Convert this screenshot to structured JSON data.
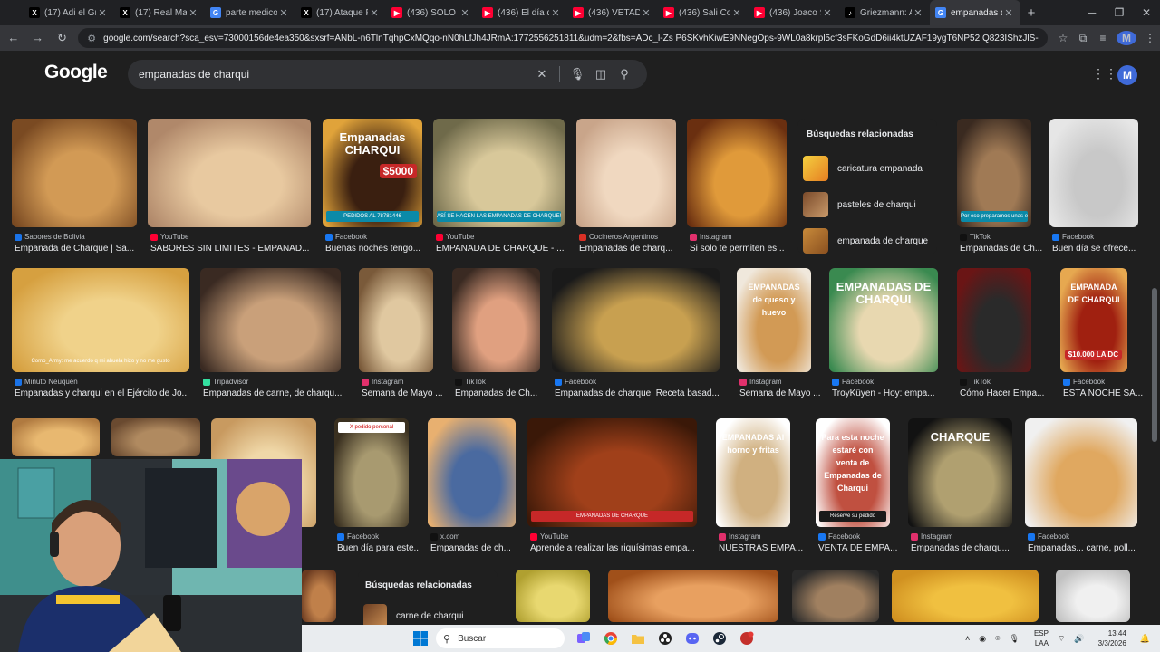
{
  "tabs": [
    {
      "title": "(17) Adi el Gra",
      "favicon": "x-icon",
      "color": "#000000",
      "active": false
    },
    {
      "title": "(17) Real Madr",
      "favicon": "x-icon",
      "color": "#000000",
      "active": false
    },
    {
      "title": "parte medico",
      "favicon": "google-icon",
      "color": "#4285f4",
      "active": false
    },
    {
      "title": "(17) Ataque Fu",
      "favicon": "x-icon",
      "color": "#000000",
      "active": false
    },
    {
      "title": "(436) SOLO en",
      "favicon": "youtube-icon",
      "color": "#ff0033",
      "active": false
    },
    {
      "title": "(436) El día qu",
      "favicon": "youtube-icon",
      "color": "#ff0033",
      "active": false
    },
    {
      "title": "(436) VETADO",
      "favicon": "youtube-icon",
      "color": "#ff0033",
      "active": false
    },
    {
      "title": "(436) Sali Con",
      "favicon": "youtube-icon",
      "color": "#ff0033",
      "active": false
    },
    {
      "title": "(436) Joaco Sa",
      "favicon": "youtube-icon",
      "color": "#ff0033",
      "active": false
    },
    {
      "title": "Griezmann: At",
      "favicon": "tiktok-icon",
      "color": "#000000",
      "active": false
    },
    {
      "title": "empanadas de",
      "favicon": "google-icon",
      "color": "#4285f4",
      "active": true
    }
  ],
  "url": "google.com/search?sca_esv=73000156de4ea350&sxsrf=ANbL-n6TlnTqhpCxMQqo-nN0hLfJh4JRmA:1772556251811&udm=2&fbs=ADc_l-Zs P6SKvhKiwE9NNegOps-9WL0a8krpl5cf3sFKoGdD6ii4ktUZAF19ygT6NP52IQ823IShzJlS-KUq5w4ku4YyIM5_w...",
  "google": {
    "logo": "Google",
    "query": "empanadas de charqui",
    "account_initial": "M"
  },
  "related_top": {
    "heading": "Búsquedas relacionadas",
    "items": [
      "caricatura empanada",
      "pasteles de charqui",
      "empanada de charque"
    ]
  },
  "related_bottom": {
    "heading": "Búsquedas relacionadas",
    "items": [
      "carne de charqui"
    ]
  },
  "results": [
    {
      "source": "Sabores de Bolivia",
      "icon_color": "#1a73e8",
      "title": "Empanada de Charque | Sa...",
      "overlay": "",
      "price": "",
      "banner": ""
    },
    {
      "source": "YouTube",
      "icon_color": "#ff0033",
      "title": "SABORES SIN LÍMITES - EMPANAD...",
      "overlay": "",
      "price": "",
      "banner": ""
    },
    {
      "source": "Facebook",
      "icon_color": "#1877f2",
      "title": "Buenas noches tengo...",
      "overlay": "PEDIDOS AL 78781446",
      "price": "$5000",
      "banner": "Empanadas CHARQUI"
    },
    {
      "source": "YouTube",
      "icon_color": "#ff0033",
      "title": "EMPANADA DE CHARQUE - ...",
      "overlay": "ASÍ SE HACEN LAS EMPANADAS DE CHARQUE!!",
      "price": "",
      "banner": ""
    },
    {
      "source": "Cocineros Argentinos",
      "icon_color": "#d93025",
      "title": "Empanadas de charq...",
      "overlay": "",
      "price": "",
      "banner": ""
    },
    {
      "source": "Instagram",
      "icon_color": "#e1306c",
      "title": "Si solo te permiten es...",
      "overlay": "",
      "price": "",
      "banner": ""
    },
    {
      "source": "TikTok",
      "icon_color": "#111111",
      "title": "Empanadas de Ch...",
      "overlay": "Por eso preparamos unas empanadas de charqui",
      "price": "",
      "banner": ""
    },
    {
      "source": "Facebook",
      "icon_color": "#1877f2",
      "title": "Buen día se ofrece...",
      "overlay": "",
      "price": "",
      "banner": ""
    },
    {
      "source": "Minuto Neuquén",
      "icon_color": "#1a73e8",
      "title": "Empanadas y charqui en el Ejército de Jo...",
      "overlay": "Como_Army: me acuerdo q mi abuela hizo y no me gusto",
      "price": "",
      "banner": ""
    },
    {
      "source": "Tripadvisor",
      "icon_color": "#34e0a1",
      "title": "Empanadas de carne, de charqu...",
      "overlay": "",
      "price": "",
      "banner": ""
    },
    {
      "source": "Instagram",
      "icon_color": "#e1306c",
      "title": "Semana de Mayo ...",
      "overlay": "",
      "price": "",
      "banner": ""
    },
    {
      "source": "TikTok",
      "icon_color": "#111111",
      "title": "Empanadas de Ch...",
      "overlay": "",
      "price": "",
      "banner": ""
    },
    {
      "source": "Facebook",
      "icon_color": "#1877f2",
      "title": "Empanadas de charque: Receta basad...",
      "overlay": "",
      "price": "",
      "banner": ""
    },
    {
      "source": "Instagram",
      "icon_color": "#e1306c",
      "title": "Semana de Mayo ...",
      "overlay": "",
      "price": "",
      "banner": "EMPANADAS de queso y huevo"
    },
    {
      "source": "Facebook",
      "icon_color": "#1877f2",
      "title": "TroyKüyen - Hoy: empa...",
      "overlay": "",
      "price": "",
      "banner": "EMPANADAS DE CHARQUI"
    },
    {
      "source": "TikTok",
      "icon_color": "#111111",
      "title": "Cómo Hacer Empa...",
      "overlay": "",
      "price": "",
      "banner": ""
    },
    {
      "source": "Facebook",
      "icon_color": "#1877f2",
      "title": "ESTA NOCHE SA...",
      "overlay": "",
      "price": "$10.000 LA DC",
      "banner": "EMPANADA DE CHARQUI"
    },
    {
      "source": "",
      "icon_color": "",
      "title": "",
      "overlay": "",
      "price": "",
      "banner": ""
    },
    {
      "source": "",
      "icon_color": "",
      "title": "",
      "overlay": "",
      "price": "",
      "banner": ""
    },
    {
      "source": "",
      "icon_color": "",
      "title": "",
      "overlay": "",
      "price": "",
      "banner": ""
    },
    {
      "source": "Facebook",
      "icon_color": "#1877f2",
      "title": "Buen día para este...",
      "overlay": "",
      "price": "",
      "banner": "",
      "tag": "X pedido personal"
    },
    {
      "source": "x.com",
      "icon_color": "#111111",
      "title": "Empanadas de ch...",
      "overlay": "",
      "price": "",
      "banner": ""
    },
    {
      "source": "YouTube",
      "icon_color": "#ff0033",
      "title": "Aprende a realizar las riquísimas empa...",
      "overlay": "EMPANADAS DE CHARQUE",
      "price": "",
      "banner": ""
    },
    {
      "source": "Instagram",
      "icon_color": "#e1306c",
      "title": "NUESTRAS EMPA...",
      "overlay": "",
      "price": "",
      "banner": "EMPANADAS Al horno y fritas"
    },
    {
      "source": "Facebook",
      "icon_color": "#1877f2",
      "title": "VENTA DE EMPA...",
      "overlay": "Reserve su pedido",
      "price": "",
      "banner": "Para esta noche estaré con venta de Empanadas de Charqui"
    },
    {
      "source": "Instagram",
      "icon_color": "#e1306c",
      "title": "Empanadas de charqu...",
      "overlay": "",
      "price": "",
      "banner": "CHARQUE"
    },
    {
      "source": "Facebook",
      "icon_color": "#1877f2",
      "title": "Empanadas... carne, poll...",
      "overlay": "",
      "price": "",
      "banner": ""
    }
  ],
  "taskbar": {
    "search_placeholder": "Buscar",
    "lang": "ESP LAA",
    "time": "13:44",
    "date": "3/3/2026"
  }
}
